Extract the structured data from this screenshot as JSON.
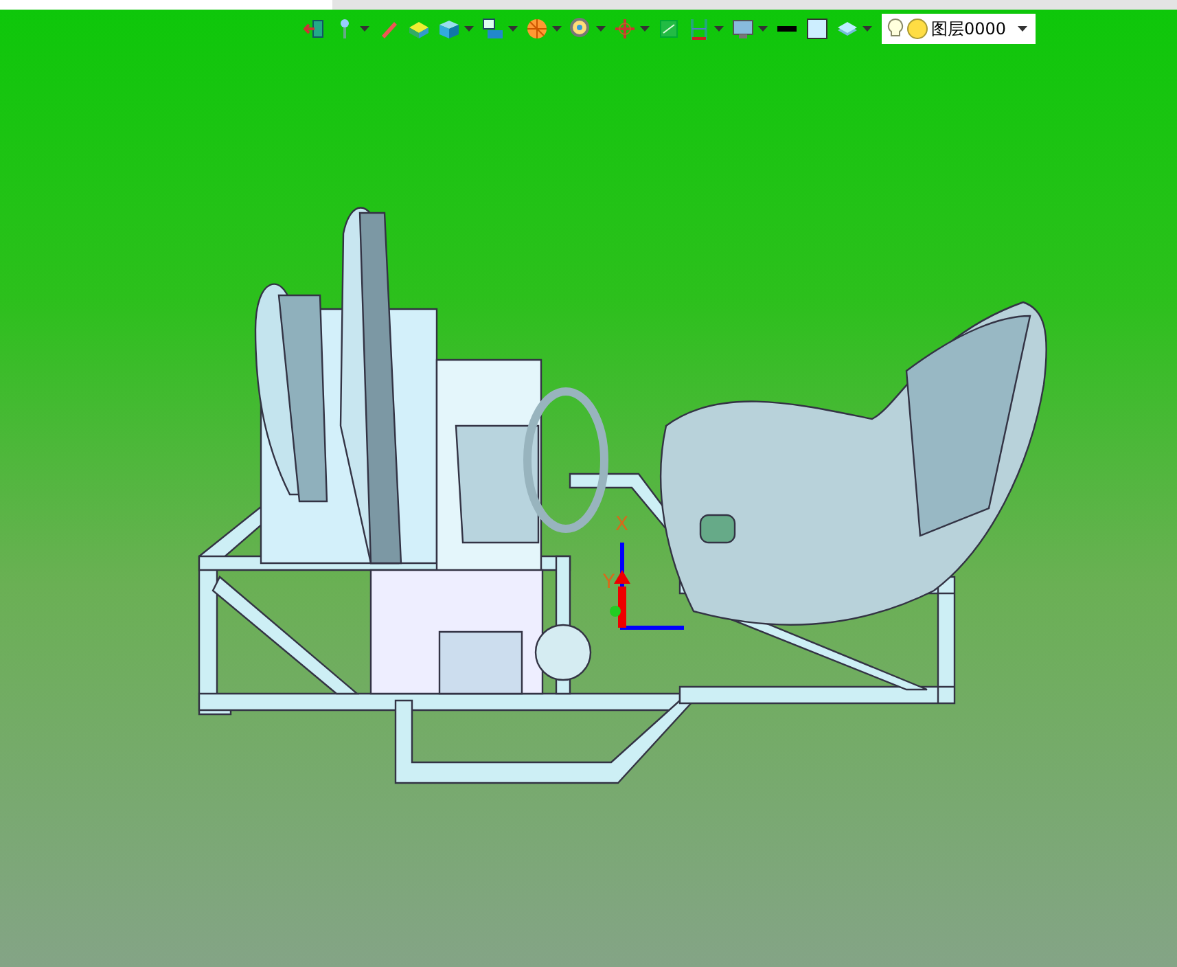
{
  "toolbar": {
    "buttons": [
      {
        "dropdown": false
      },
      {
        "dropdown": true
      },
      {
        "dropdown": false
      },
      {
        "dropdown": false
      },
      {
        "dropdown": true
      },
      {
        "dropdown": true
      },
      {
        "dropdown": true
      },
      {
        "dropdown": true
      },
      {
        "dropdown": true
      },
      {
        "dropdown": false
      },
      {
        "dropdown": true
      },
      {
        "dropdown": true
      },
      {
        "dropdown": false
      },
      {
        "dropdown": false
      },
      {
        "dropdown": true
      }
    ],
    "layer_selector": {
      "value": "图层0000"
    }
  },
  "viewport": {
    "axis_labels": [
      "X",
      "Y"
    ]
  }
}
